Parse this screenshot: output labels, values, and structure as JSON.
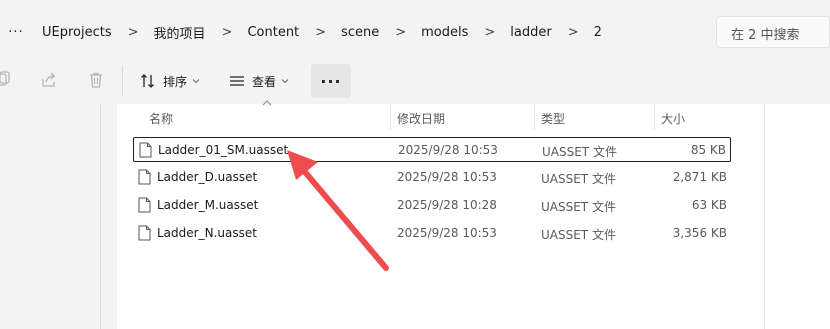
{
  "address": {
    "more_glyph": "···",
    "crumbs": [
      "UEprojects",
      "我的项目",
      "Content",
      "scene",
      "models",
      "ladder",
      "2"
    ],
    "separator": ">"
  },
  "search": {
    "placeholder": "在 2 中搜索"
  },
  "toolbar": {
    "sort_label": "排序",
    "view_label": "查看",
    "more_glyph": "···"
  },
  "columns": {
    "name": "名称",
    "modified": "修改日期",
    "type": "类型",
    "size": "大小"
  },
  "files": [
    {
      "name": "Ladder_01_SM.uasset",
      "modified": "2025/9/28 10:53",
      "type": "UASSET 文件",
      "size": "85 KB",
      "selected": true
    },
    {
      "name": "Ladder_D.uasset",
      "modified": "2025/9/28 10:53",
      "type": "UASSET 文件",
      "size": "2,871 KB",
      "selected": false
    },
    {
      "name": "Ladder_M.uasset",
      "modified": "2025/9/28 10:28",
      "type": "UASSET 文件",
      "size": "63 KB",
      "selected": false
    },
    {
      "name": "Ladder_N.uasset",
      "modified": "2025/9/28 10:53",
      "type": "UASSET 文件",
      "size": "3,356 KB",
      "selected": false
    }
  ],
  "colors": {
    "arrow": "#ee4d4d",
    "selection_border": "#1f1f1f",
    "window_bg": "#f3f3f3"
  }
}
